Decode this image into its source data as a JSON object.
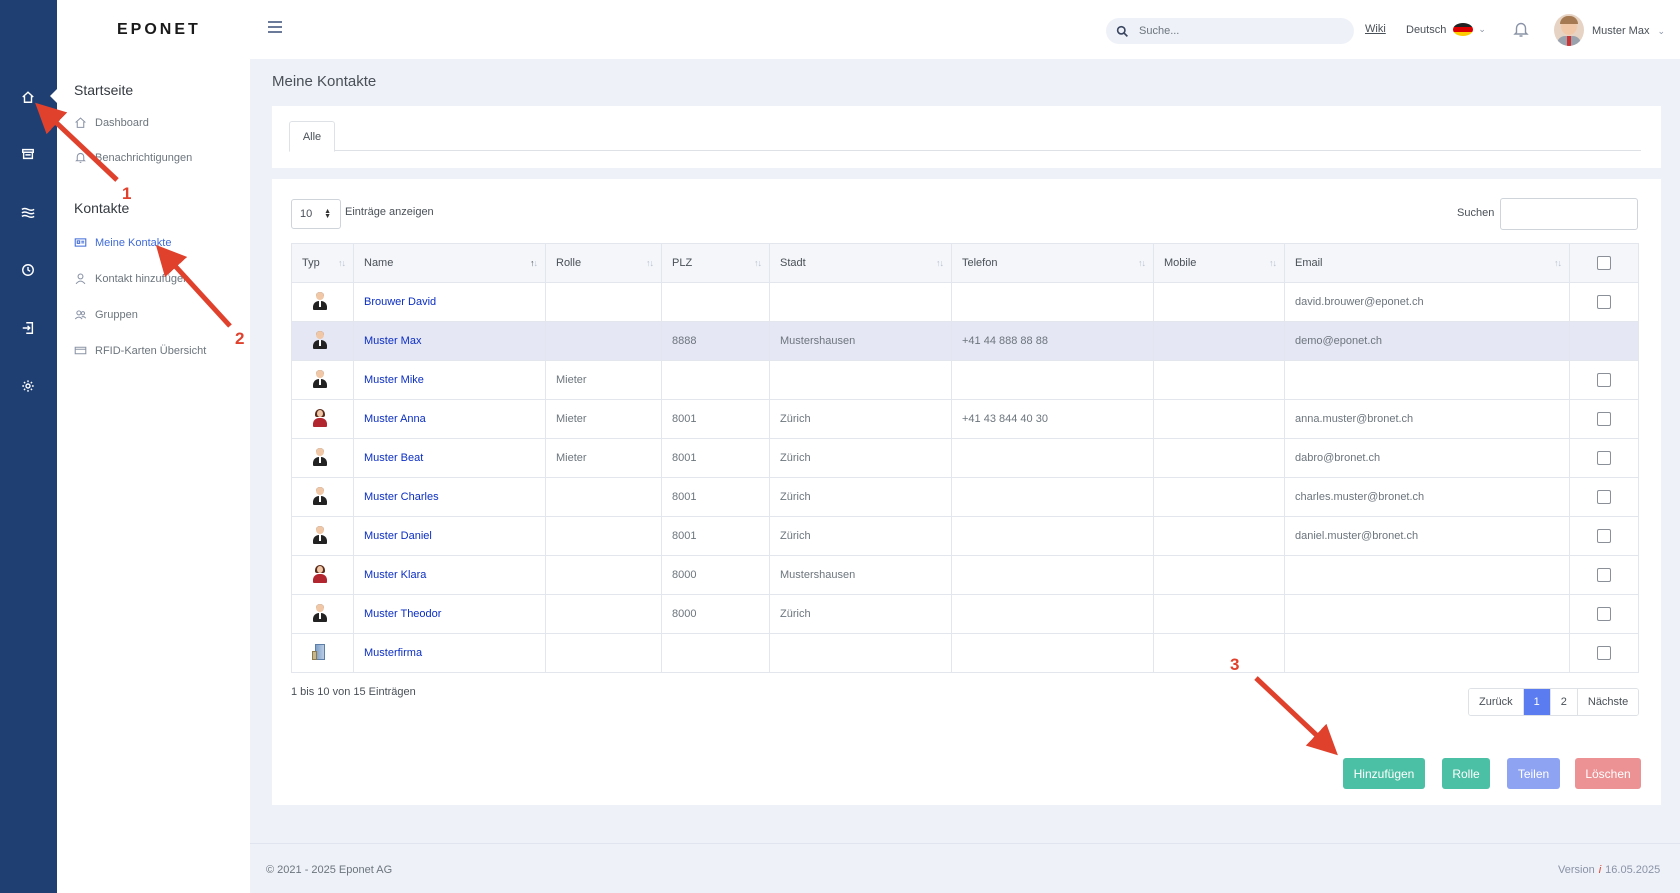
{
  "app": {
    "logo": "EPONET"
  },
  "header": {
    "search_placeholder": "Suche...",
    "wiki": "Wiki",
    "language": "Deutsch",
    "user_name": "Muster Max"
  },
  "sidebar": {
    "section1": "Startseite",
    "dashboard": "Dashboard",
    "notifications": "Benachrichtigungen",
    "section2": "Kontakte",
    "my_contacts": "Meine Kontakte",
    "add_contact": "Kontakt hinzufügen",
    "groups": "Gruppen",
    "rfid": "RFID-Karten Übersicht"
  },
  "page": {
    "title": "Meine Kontakte",
    "tab_all": "Alle",
    "page_length": "10",
    "page_length_label": "Einträge anzeigen",
    "search_label": "Suchen",
    "info": "1 bis 10 von 15 Einträgen"
  },
  "table": {
    "headers": [
      "Typ",
      "Name",
      "Rolle",
      "PLZ",
      "Stadt",
      "Telefon",
      "Mobile",
      "Email"
    ],
    "rows": [
      {
        "type": "male",
        "name": "Brouwer David",
        "rolle": "",
        "plz": "",
        "stadt": "",
        "telefon": "",
        "mobile": "",
        "email": "david.brouwer@eponet.ch",
        "checkbox": true
      },
      {
        "type": "male",
        "name": "Muster Max",
        "rolle": "",
        "plz": "8888",
        "stadt": "Mustershausen",
        "telefon": "+41 44 888 88 88",
        "mobile": "",
        "email": "demo@eponet.ch",
        "checkbox": false
      },
      {
        "type": "male",
        "name": "Muster Mike",
        "rolle": "Mieter",
        "plz": "",
        "stadt": "",
        "telefon": "",
        "mobile": "",
        "email": "",
        "checkbox": true
      },
      {
        "type": "female",
        "name": "Muster Anna",
        "rolle": "Mieter",
        "plz": "8001",
        "stadt": "Zürich",
        "telefon": "+41 43 844 40 30",
        "mobile": "",
        "email": "anna.muster@bronet.ch",
        "checkbox": true
      },
      {
        "type": "male",
        "name": "Muster Beat",
        "rolle": "Mieter",
        "plz": "8001",
        "stadt": "Zürich",
        "telefon": "",
        "mobile": "",
        "email": "dabro@bronet.ch",
        "checkbox": true
      },
      {
        "type": "male",
        "name": "Muster Charles",
        "rolle": "",
        "plz": "8001",
        "stadt": "Zürich",
        "telefon": "",
        "mobile": "",
        "email": "charles.muster@bronet.ch",
        "checkbox": true
      },
      {
        "type": "male",
        "name": "Muster Daniel",
        "rolle": "",
        "plz": "8001",
        "stadt": "Zürich",
        "telefon": "",
        "mobile": "",
        "email": "daniel.muster@bronet.ch",
        "checkbox": true
      },
      {
        "type": "female",
        "name": "Muster Klara",
        "rolle": "",
        "plz": "8000",
        "stadt": "Mustershausen",
        "telefon": "",
        "mobile": "",
        "email": "",
        "checkbox": true
      },
      {
        "type": "male",
        "name": "Muster Theodor",
        "rolle": "",
        "plz": "8000",
        "stadt": "Zürich",
        "telefon": "",
        "mobile": "",
        "email": "",
        "checkbox": true
      },
      {
        "type": "company",
        "name": "Musterfirma",
        "rolle": "",
        "plz": "",
        "stadt": "",
        "telefon": "",
        "mobile": "",
        "email": "",
        "checkbox": true
      }
    ]
  },
  "pager": {
    "prev": "Zurück",
    "p1": "1",
    "p2": "2",
    "next": "Nächste"
  },
  "buttons": {
    "add": "Hinzufügen",
    "role": "Rolle",
    "share": "Teilen",
    "delete": "Löschen"
  },
  "colors": {
    "add": "#4cc0a4",
    "role": "#4cc0a4",
    "share": "#8fa3f3",
    "delete": "#ec9294",
    "annotation": "#e0412c"
  },
  "annotations": [
    "1",
    "2",
    "3"
  ],
  "footer": {
    "copyright": "© 2021 - 2025 Eponet AG",
    "version_label": "Version",
    "version_icon": "i",
    "version_date": "16.05.2025"
  }
}
